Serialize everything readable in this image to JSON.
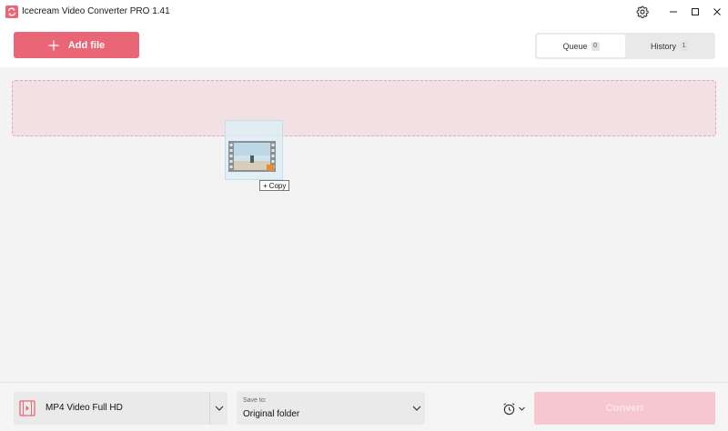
{
  "window": {
    "title": "Icecream Video Converter PRO 1.41"
  },
  "toolbar": {
    "add_file_label": "Add file"
  },
  "tabs": [
    {
      "label": "Queue",
      "count": "0",
      "active": true
    },
    {
      "label": "History",
      "count": "1",
      "active": false
    }
  ],
  "drag": {
    "tooltip_label": "Copy"
  },
  "footer": {
    "format_label": "MP4 Video Full HD",
    "save_caption": "Save to:",
    "save_value": "Original folder",
    "convert_label": "Convert"
  },
  "colors": {
    "accent": "#e96677",
    "drop_zone": "#f2e1e4",
    "convert_disabled": "#f6c7cf"
  },
  "icons": {
    "app": "app-logo-icon",
    "settings": "gear-icon",
    "minimize": "minimize-icon",
    "maximize": "maximize-icon",
    "close": "close-icon",
    "add": "plus-icon",
    "format": "film-icon",
    "timer": "alarm-clock-icon"
  }
}
